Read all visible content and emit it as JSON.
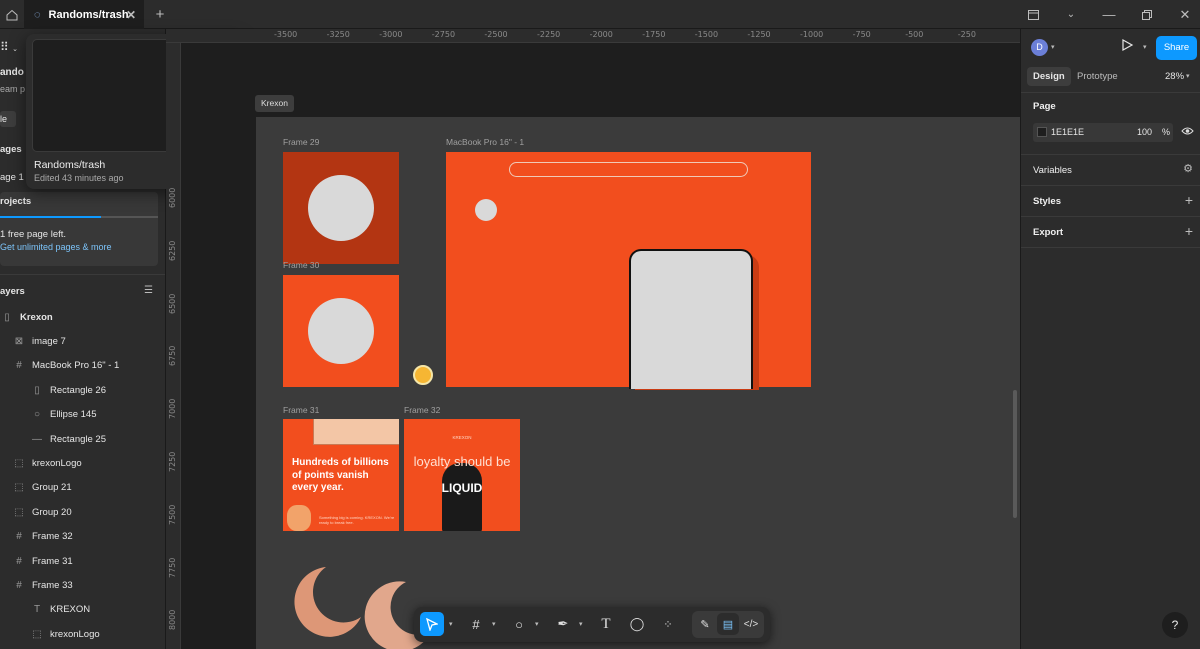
{
  "titlebar": {
    "tab_title": "Randoms/trash",
    "new_tab": "+",
    "home_icon": "home-icon"
  },
  "popup": {
    "file_name": "Randoms/trash",
    "edited": "Edited 43 minutes ago"
  },
  "left_panel": {
    "file_name_partial": "ando",
    "team_partial": "eam p",
    "file_chip": "le",
    "pages_header": "ages",
    "page1": "age 1",
    "projects_header": "rojects",
    "free_pages": "1 free page left.",
    "unlimited_link": "Get unlimited pages & more",
    "layers_header": "ayers",
    "layers": [
      {
        "label": "Krexon",
        "icon": "page-icon",
        "indent": 0
      },
      {
        "label": "image 7",
        "icon": "image-icon",
        "indent": 1
      },
      {
        "label": "MacBook Pro 16\" - 1",
        "icon": "frame-icon",
        "indent": 1
      },
      {
        "label": "Rectangle 26",
        "icon": "rectangle-icon",
        "indent": 2
      },
      {
        "label": "Ellipse 145",
        "icon": "ellipse-icon",
        "indent": 2
      },
      {
        "label": "Rectangle 25",
        "icon": "line-icon",
        "indent": 2
      },
      {
        "label": "krexonLogo",
        "icon": "group-icon",
        "indent": 1
      },
      {
        "label": "Group 21",
        "icon": "group-icon",
        "indent": 1
      },
      {
        "label": "Group 20",
        "icon": "group-icon",
        "indent": 1
      },
      {
        "label": "Frame 32",
        "icon": "frame-icon",
        "indent": 1
      },
      {
        "label": "Frame 31",
        "icon": "frame-icon",
        "indent": 1
      },
      {
        "label": "Frame 33",
        "icon": "frame-icon",
        "indent": 1
      },
      {
        "label": "KREXON",
        "icon": "text-icon",
        "indent": 2
      },
      {
        "label": "krexonLogo",
        "icon": "group-icon",
        "indent": 2
      }
    ]
  },
  "ruler": {
    "top": [
      "-3500",
      "-3250",
      "-3000",
      "-2750",
      "-2500",
      "-2250",
      "-2000",
      "-1750",
      "-1500",
      "-1250",
      "-1000",
      "-750",
      "-500",
      "-250"
    ],
    "left": [
      "6000",
      "6250",
      "6500",
      "6750",
      "7000",
      "7250",
      "7500",
      "7750",
      "8000"
    ]
  },
  "canvas": {
    "page_tag": "Krexon",
    "frame29": "Frame 29",
    "frame30": "Frame 30",
    "frame31": "Frame 31",
    "frame32": "Frame 32",
    "macbook": "MacBook Pro 16\" - 1",
    "frame31_text": "Hundreds of billions of points vanish every year.",
    "frame31_small": "Something big is coming. KREXON. We're ready to break free.",
    "frame32_logo": "KREXON",
    "frame32_line1": "loyalty should be",
    "frame32_line2": "LIQUID",
    "colors": {
      "orange": "#f24e1e",
      "dark_orange": "#b33512",
      "circle": "#d9d9d9"
    }
  },
  "right_panel": {
    "avatar": "D",
    "share": "Share",
    "tab_design": "Design",
    "tab_prototype": "Prototype",
    "zoom": "28%",
    "page_section": "Page",
    "page_color": "1E1E1E",
    "opacity": "100",
    "pct": "%",
    "variables": "Variables",
    "styles": "Styles",
    "export": "Export"
  },
  "help": "?"
}
